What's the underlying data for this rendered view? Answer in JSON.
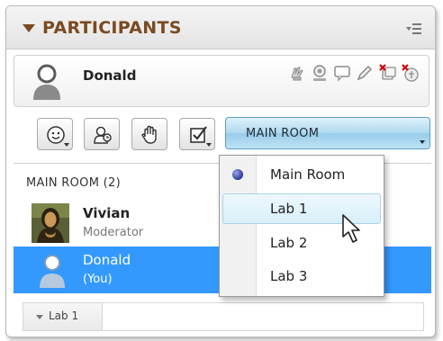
{
  "header": {
    "title": "PARTICIPANTS",
    "menu_icon": "panel-menu-icon"
  },
  "me": {
    "name": "Donald",
    "status_icons": [
      "raise-hand-status-icon",
      "agree-status-icon",
      "chat-status-icon",
      "edit-status-icon",
      "no-video-status-icon",
      "no-audio-status-icon"
    ]
  },
  "toolbar": {
    "buttons": [
      "emoticon-icon",
      "permissions-icon",
      "raise-hand-icon",
      "poll-icon"
    ],
    "room_select": {
      "value": "MAIN ROOM"
    }
  },
  "list": {
    "group_label": "MAIN ROOM (2)",
    "participants": [
      {
        "name": "Vivian",
        "role": "Moderator"
      },
      {
        "name": "Donald",
        "role": "(You)"
      }
    ],
    "lab_section": "Lab 1"
  },
  "dropdown": {
    "options": [
      "Main Room",
      "Lab 1",
      "Lab 2",
      "Lab 3"
    ],
    "selected": "Main Room",
    "hovered": "Lab 1"
  },
  "colors": {
    "header_text": "#7a4a22",
    "selection": "#3399ff",
    "room_select": "#aed8ef"
  }
}
